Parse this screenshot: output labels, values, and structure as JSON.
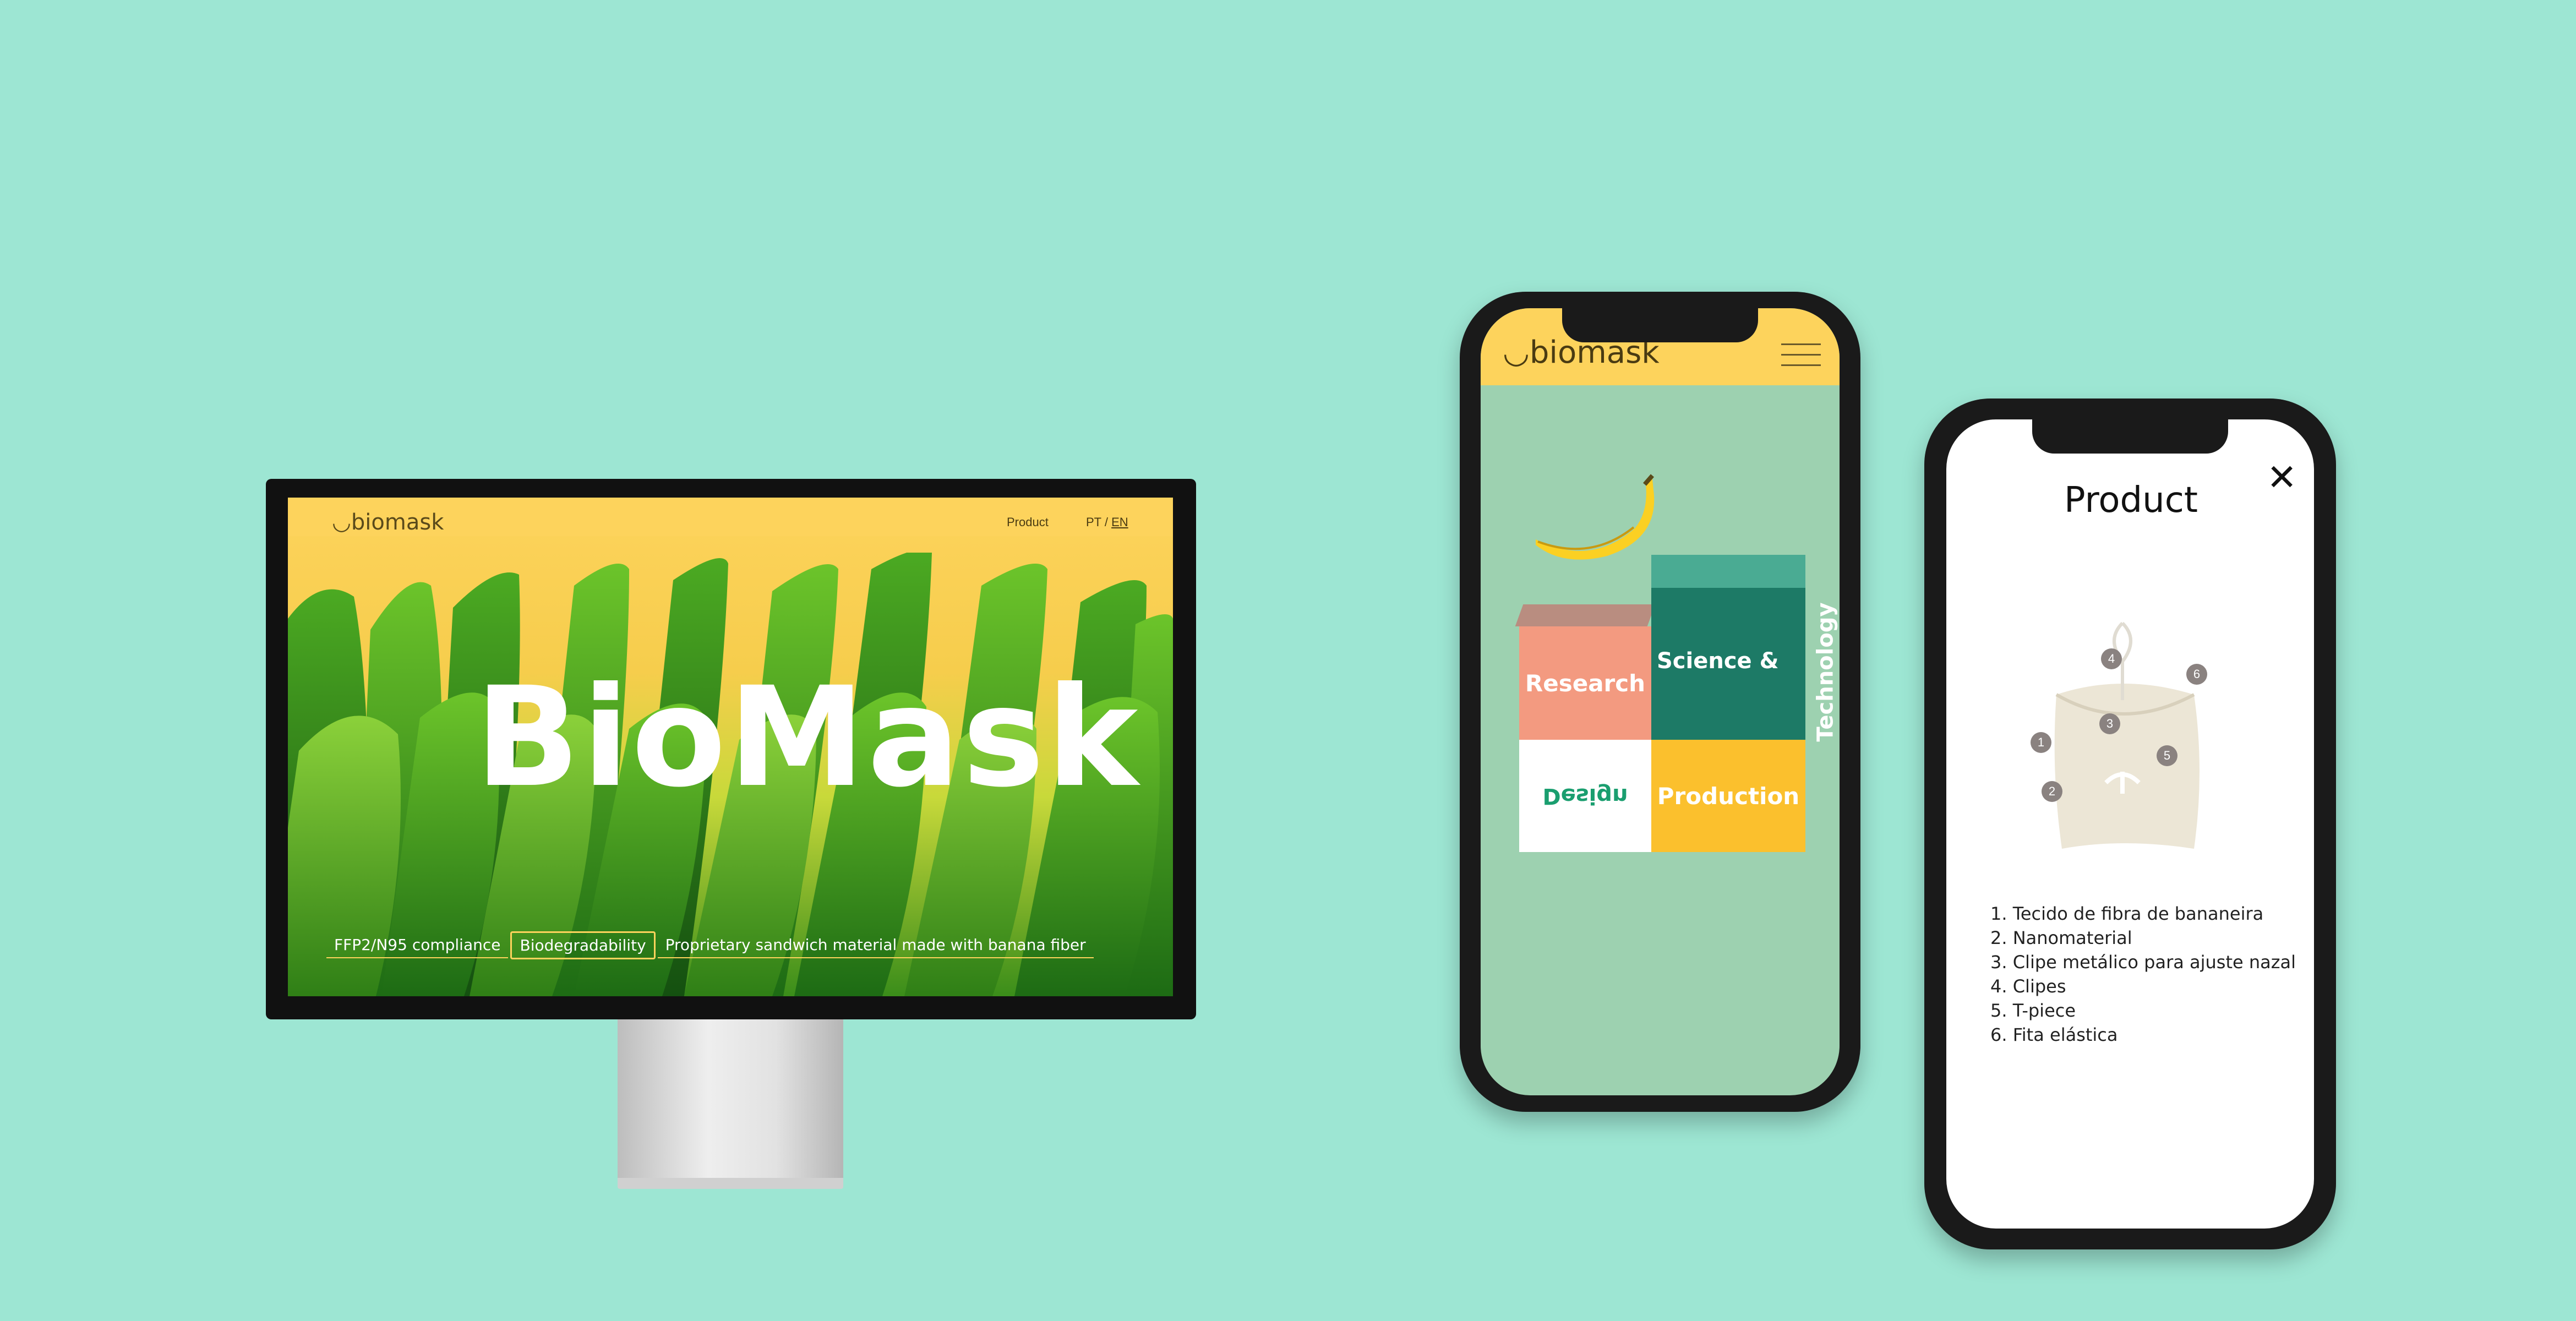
{
  "desktop": {
    "brand": "biomask",
    "nav": {
      "product": "Product",
      "lang_pt": "PT",
      "lang_sep": "/",
      "lang_en": "EN"
    },
    "hero_title": "BioMask",
    "features": [
      "FFP2/N95 compliance",
      "Biodegradability",
      "Proprietary sandwich material made with banana fiber"
    ]
  },
  "phone_home": {
    "brand": "biomask",
    "blocks": {
      "research": "Research",
      "science": "Science &",
      "technology": "Technology",
      "design": "Design",
      "production": "Production"
    }
  },
  "phone_product": {
    "title": "Product",
    "parts_labels": [
      "1",
      "2",
      "3",
      "4",
      "5",
      "6"
    ],
    "parts": [
      "1. Tecido de fibra de bananeira",
      "2. Nanomaterial",
      "3. Clipe metálico para ajuste nazal",
      "4. Clipes",
      "5. T-piece",
      "6. Fita elástica"
    ]
  },
  "colors": {
    "background": "#9de6d3",
    "yellow": "#fdd35c",
    "leaf_green": "#3f9a1c",
    "teal_dark": "#1d7a66",
    "salmon": "#f39a80",
    "production_yellow": "#fbc02d",
    "design_green": "#1a9e6f"
  }
}
